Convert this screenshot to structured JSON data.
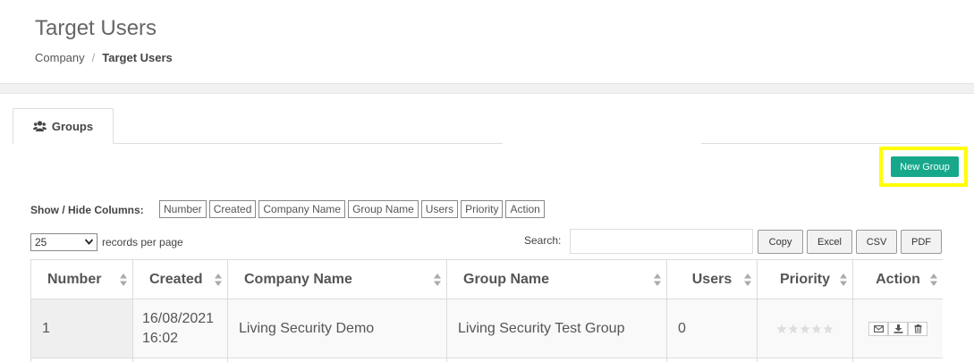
{
  "header": {
    "title": "Target Users",
    "breadcrumb": {
      "parent": "Company",
      "separator": "/",
      "current": "Target Users"
    }
  },
  "tabs": [
    {
      "label": "Groups",
      "icon": "users-icon",
      "active": true
    }
  ],
  "toolbar": {
    "new_group_label": "New Group",
    "highlight_color": "#ffff00",
    "accent": "#17a88b"
  },
  "columns_control": {
    "label": "Show / Hide Columns:",
    "toggles": [
      "Number",
      "Created",
      "Company Name",
      "Group Name",
      "Users",
      "Priority",
      "Action"
    ]
  },
  "length_control": {
    "selected": "25",
    "label": "records per page"
  },
  "search": {
    "label": "Search:",
    "value": ""
  },
  "export_buttons": [
    "Copy",
    "Excel",
    "CSV",
    "PDF"
  ],
  "table": {
    "columns": [
      "Number",
      "Created",
      "Company Name",
      "Group Name",
      "Users",
      "Priority",
      "Action"
    ],
    "rows": [
      {
        "number": "1",
        "created_date": "16/08/2021",
        "created_time": "16:02",
        "company": "Living Security Demo",
        "group": "Living Security Test Group",
        "users": "0",
        "priority_stars": 0,
        "actions": [
          "mail-icon",
          "download-icon",
          "trash-icon"
        ]
      }
    ]
  }
}
